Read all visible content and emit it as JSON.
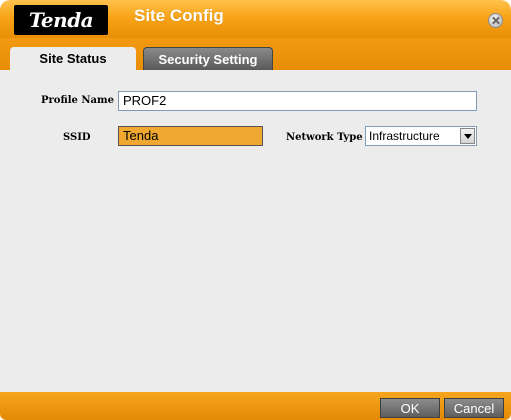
{
  "window": {
    "logo_text": "Tenda",
    "title": "Site Config"
  },
  "tabs": [
    {
      "label": "Site Status",
      "active": true
    },
    {
      "label": "Security Setting",
      "active": false
    }
  ],
  "form": {
    "profile_name_label": "Profile Name",
    "profile_name_value": "PROF2",
    "ssid_label": "SSID",
    "ssid_value": "Tenda",
    "network_type_label": "Network Type",
    "network_type_value": "Infrastructure"
  },
  "buttons": {
    "ok": "OK",
    "cancel": "Cancel"
  },
  "icons": {
    "close": "close-icon",
    "dropdown": "chevron-down-icon"
  },
  "colors": {
    "accent_orange": "#f39a12",
    "focused_field": "#f0a830",
    "button_gray": "#6e6e6e"
  }
}
